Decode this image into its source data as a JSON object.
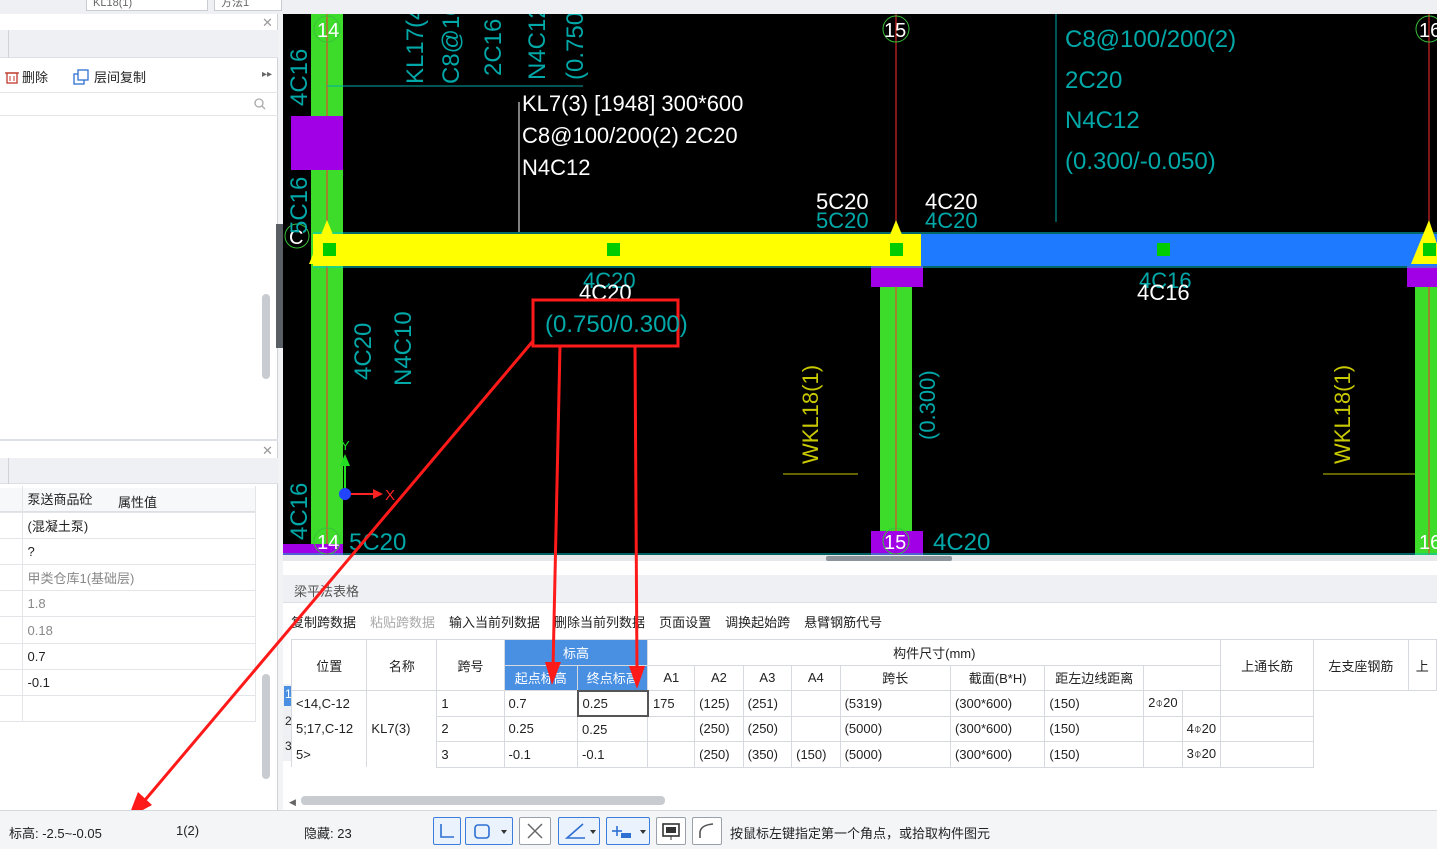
{
  "tabs": [
    "KL18(1)",
    "方法1"
  ],
  "left_toolbar": {
    "delete_label": "删除",
    "copy_label": "层间复制"
  },
  "props": {
    "header": "属性值",
    "values": [
      "泵送商品砼",
      "(混凝土泵)",
      "?",
      "甲类仓库1(基础层)",
      "1.8",
      "0.18",
      "0.7",
      "-0.1"
    ]
  },
  "cad": {
    "axis_labels": {
      "a14": "14",
      "a15": "15",
      "a16": "16",
      "c": "C",
      "a14b": "14",
      "a15b": "15",
      "a16b": "16"
    },
    "beam_label": {
      "line1": "KL7(3) [1948] 300*600",
      "line2": "C8@100/200(2) 2C20",
      "line3": "N4C12"
    },
    "top_left_vert": [
      "KL17(4",
      "C8@100",
      "2C16",
      "N4C12",
      "(0.750)"
    ],
    "right_annot": [
      "C8@100/200(2)",
      "2C20",
      "N4C12",
      "(0.300/-0.050)"
    ],
    "left_col_text": [
      "4C16",
      "5C16",
      "4C20",
      "N4C10",
      "4C16",
      "5C20"
    ],
    "seat_left": "5C20",
    "seat_left_ghost": "5C20",
    "seat_right": "4C20",
    "seat_right_ghost": "4C20",
    "bottom_left": "4C20",
    "bottom_left_ghost": "4C20",
    "elev_box": "(0.750/0.300)",
    "bottom_right": "4C16",
    "bottom_right_ghost": "4C16",
    "wkl_left": "WKL18(1)",
    "wkl_right": "WKL18(1)",
    "col_elev": "(0.300)",
    "bottom_rebar": "4C20",
    "axis_x": "X",
    "axis_y": "Y"
  },
  "table": {
    "title": "梁平法表格",
    "toolbar": [
      "复制跨数据",
      "粘贴跨数据",
      "输入当前列数据",
      "删除当前列数据",
      "页面设置",
      "调换起始跨",
      "悬臂钢筋代号"
    ],
    "headers": {
      "pos": "位置",
      "name": "名称",
      "span": "跨号",
      "elev": "标高",
      "start": "起点标高",
      "end": "终点标高",
      "a1": "A1",
      "a2": "A2",
      "a3": "A3",
      "a4": "A4",
      "size": "构件尺寸(mm)",
      "spanlen": "跨长",
      "section": "截面(B*H)",
      "edge": "距左边线距离",
      "top": "上通长筋",
      "leftseat": "左支座钢筋",
      "more": "上"
    },
    "rownums": [
      "1",
      "2",
      "3"
    ],
    "position": [
      "<14,C-12",
      "5;17,C-12",
      "5>"
    ],
    "name": "KL7(3)",
    "rows": [
      {
        "span": "1",
        "start": "0.7",
        "end": "0.25",
        "a1": "175",
        "a2": "(125)",
        "a3": "(251)",
        "a4": "",
        "len": "(5319)",
        "sec": "(300*600)",
        "edge": "(150)",
        "top": "2⌽20",
        "seat": ""
      },
      {
        "span": "2",
        "start": "0.25",
        "end": "0.25",
        "a1": "",
        "a2": "(250)",
        "a3": "(250)",
        "a4": "",
        "len": "(5000)",
        "sec": "(300*600)",
        "edge": "(150)",
        "top": "",
        "seat": "4⌽20"
      },
      {
        "span": "3",
        "start": "-0.1",
        "end": "-0.1",
        "a1": "",
        "a2": "(250)",
        "a3": "(350)",
        "a4": "(150)",
        "len": "(5000)",
        "sec": "(300*600)",
        "edge": "(150)",
        "top": "",
        "seat": "3⌽20"
      }
    ]
  },
  "status": {
    "elev": "标高:  -2.5~-0.05",
    "layer": "1(2)",
    "hidden": "隐藏:  23",
    "hint": "按鼠标左键指定第一个角点，或拾取构件图元"
  },
  "colors": {
    "beam_yellow": "#ffff00",
    "beam_blue": "#1e7bff",
    "column_green": "#3ddc2b",
    "joint_purple": "#a100e6",
    "annotation": "#00a8a8",
    "arrow_red": "#ff1a1a"
  }
}
